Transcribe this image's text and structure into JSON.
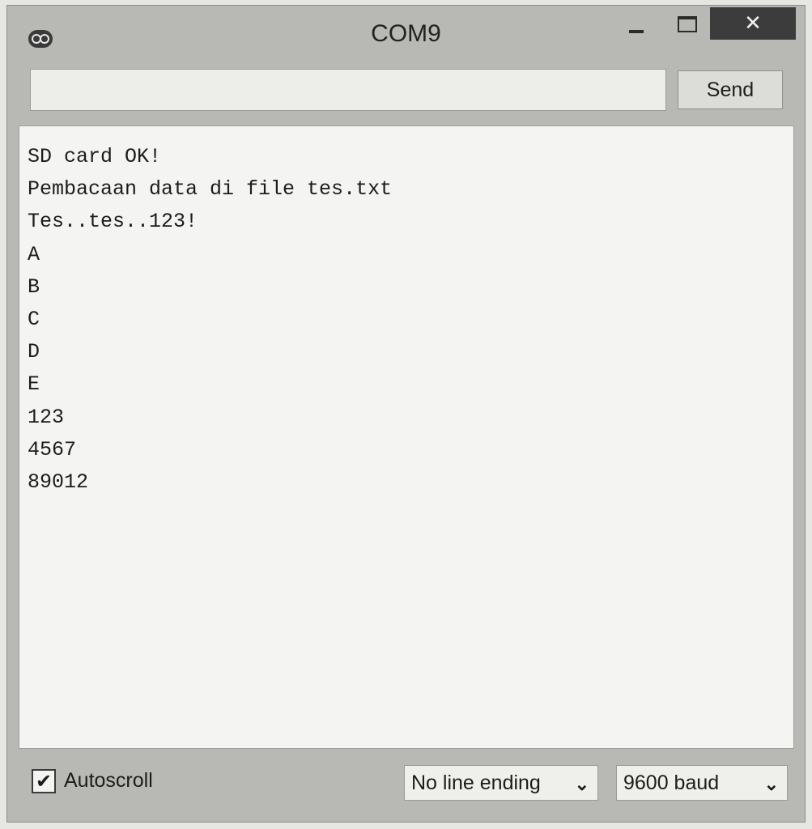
{
  "window": {
    "title": "COM9",
    "close_glyph": "✕",
    "app_icon": "arduino-icon"
  },
  "send_bar": {
    "input_value": "",
    "send_label": "Send"
  },
  "serial_output": {
    "lines": [
      "SD card OK!",
      "Pembacaan data di file tes.txt",
      "Tes..tes..123!",
      "A",
      "B",
      "C",
      "D",
      "E",
      "123",
      "4567",
      "89012"
    ]
  },
  "status_bar": {
    "autoscroll_label": "Autoscroll",
    "autoscroll_checked": true,
    "checkmark_glyph": "✔",
    "line_ending": "No line ending",
    "baud_rate": "9600 baud",
    "chevron_glyph": "⌄"
  }
}
